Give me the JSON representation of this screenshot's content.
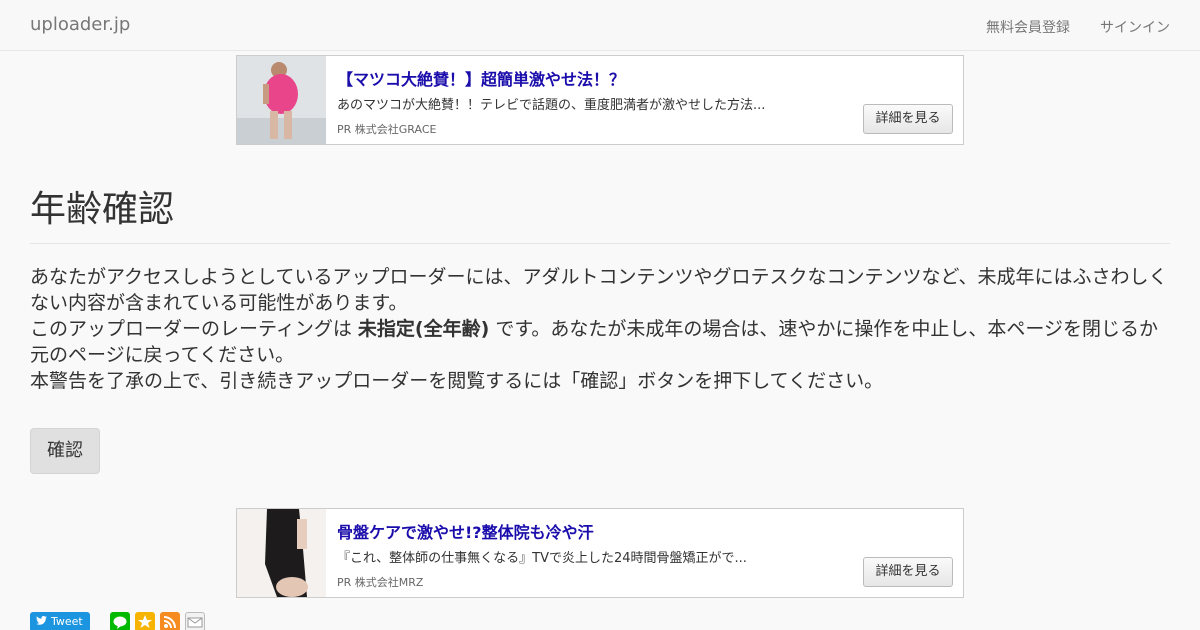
{
  "navbar": {
    "brand": "uploader.jp",
    "register": "無料会員登録",
    "signin": "サインイン"
  },
  "ads": [
    {
      "title": "【マツコ大絶賛！】超簡単激やせ法！？",
      "description": "あのマツコが大絶賛！！テレビで話題の、重度肥満者が激やせした方法...",
      "sponsor": "PR  株式会社GRACE",
      "button": "詳細を見る"
    },
    {
      "title": "骨盤ケアで激やせ!?整体院も冷や汗",
      "description": "『これ、整体師の仕事無くなる』TVで炎上した24時間骨盤矯正がで...",
      "sponsor": "PR  株式会社MRZ",
      "button": "詳細を見る"
    }
  ],
  "main": {
    "title": "年齢確認",
    "para1": "あなたがアクセスしようとしているアップローダーには、アダルトコンテンツやグロテスクなコンテンツなど、未成年にはふさわしくない内容が含まれている可能性があります。",
    "para2_pre": "このアップローダーのレーティングは ",
    "para2_rating": "未指定(全年齢)",
    "para2_post": " です。あなたが未成年の場合は、速やかに操作を中止し、本ページを閉じるか元のページに戻ってください。",
    "para3": "本警告を了承の上で、引き続きアップローダーを閲覧するには「確認」ボタンを押下してください。",
    "confirm_button": "確認"
  },
  "share": {
    "tweet_label": "Tweet",
    "icons": [
      "line-icon",
      "star-icon",
      "rss-icon",
      "mail-icon"
    ]
  }
}
